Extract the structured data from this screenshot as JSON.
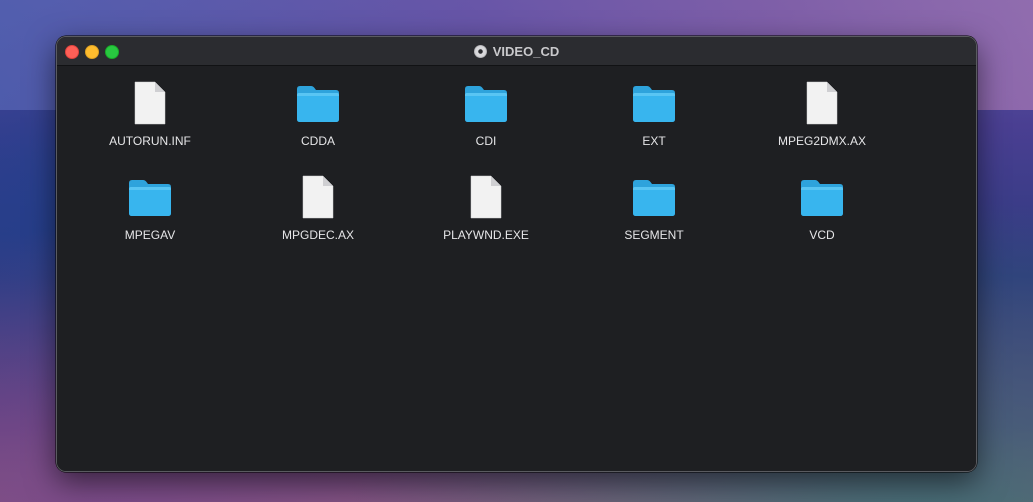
{
  "window": {
    "title": "VIDEO_CD",
    "title_icon": "disc-icon"
  },
  "colors": {
    "folder": "#38b5ee",
    "folder_tab": "#2ea3dc",
    "document": "#f2f2f2",
    "close": "#fe5f57",
    "minimize": "#febc2e",
    "zoom": "#28c840"
  },
  "items": [
    {
      "label": "AUTORUN.INF",
      "kind": "document"
    },
    {
      "label": "CDDA",
      "kind": "folder"
    },
    {
      "label": "CDI",
      "kind": "folder"
    },
    {
      "label": "EXT",
      "kind": "folder"
    },
    {
      "label": "MPEG2DMX.AX",
      "kind": "document"
    },
    {
      "label": "MPEGAV",
      "kind": "folder"
    },
    {
      "label": "MPGDEC.AX",
      "kind": "document"
    },
    {
      "label": "PLAYWND.EXE",
      "kind": "document"
    },
    {
      "label": "SEGMENT",
      "kind": "folder"
    },
    {
      "label": "VCD",
      "kind": "folder"
    }
  ]
}
